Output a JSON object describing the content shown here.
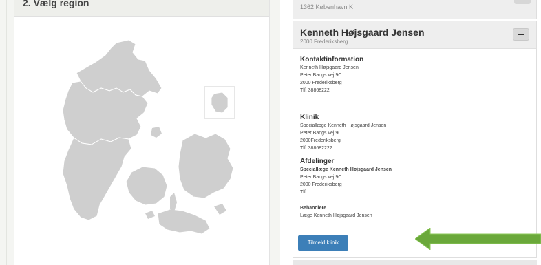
{
  "region": {
    "title": "2. Vælg region"
  },
  "previous_clinic": {
    "address": "1362 København K"
  },
  "clinic": {
    "name": "Kenneth Højsgaard Jensen",
    "city": "2000 Frederiksberg",
    "contact": {
      "heading": "Kontaktinformation",
      "lines": [
        "Kenneth Højsgaard Jensen",
        "Peter Bangs vej 9C",
        "2000 Frederiksberg",
        "Tlf. 38868222"
      ]
    },
    "klinik": {
      "heading": "Klinik",
      "lines": [
        "Speciallæge Kenneth Højsgaard Jensen",
        "Peter Bangs vej 9C",
        "2000Frederiksberg",
        "Tlf. 388682222"
      ]
    },
    "afdelinger": {
      "heading": "Afdelinger",
      "name": "Speciallæge Kenneth Højsgaard Jensen",
      "lines": [
        "Peter Bangs vej 9C",
        "2000 Frederiksberg",
        "Tlf."
      ]
    },
    "behandlere": {
      "heading": "Behandlere",
      "lines": [
        "Læge Kenneth Højsgaard Jensen"
      ]
    },
    "signup_label": "Tilmeld klinik"
  },
  "colors": {
    "map_fill": "#cfcfcf",
    "map_stroke": "#ffffff",
    "button": "#3c7fb8",
    "arrow": "#6aa83a"
  }
}
